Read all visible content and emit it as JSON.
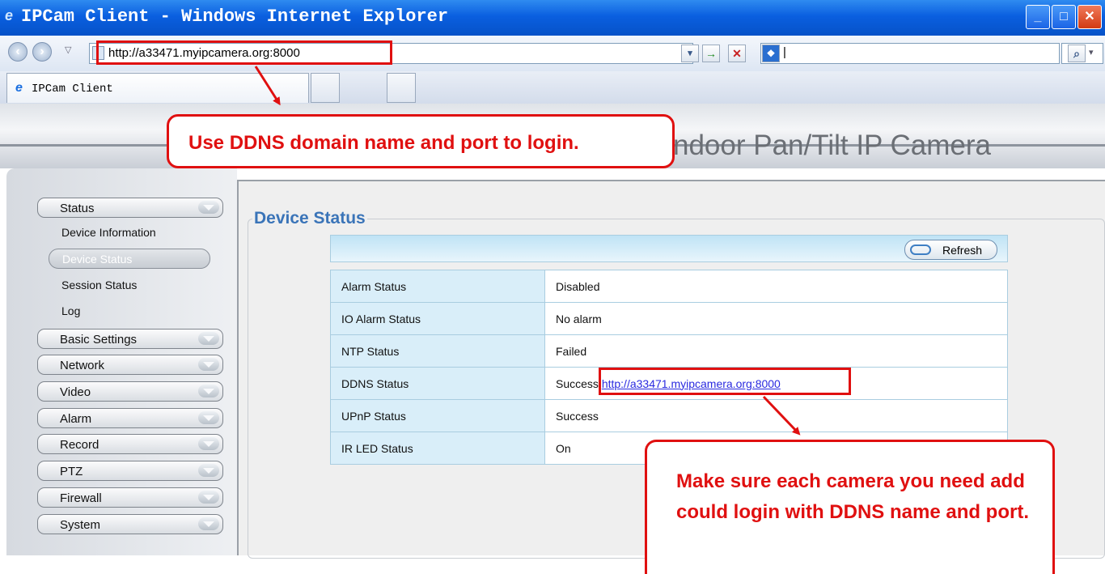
{
  "window": {
    "title": "IPCam Client - Windows Internet Explorer"
  },
  "browser": {
    "address": "http://a33471.myipcamera.org:8000",
    "search_text": "|",
    "tab_title": "IPCam Client"
  },
  "banner": {
    "title": "ndoor Pan/Tilt IP Camera"
  },
  "sidebar": {
    "status_menu": "Status",
    "status_items": [
      "Device Information",
      "Device Status",
      "Session Status",
      "Log"
    ],
    "menus": [
      "Basic Settings",
      "Network",
      "Video",
      "Alarm",
      "Record",
      "PTZ",
      "Firewall",
      "System"
    ]
  },
  "main": {
    "section_title": "Device Status",
    "refresh_label": "Refresh",
    "rows": [
      {
        "key": "Alarm Status",
        "value": "Disabled"
      },
      {
        "key": "IO Alarm Status",
        "value": "No alarm"
      },
      {
        "key": "NTP Status",
        "value": "Failed"
      },
      {
        "key": "DDNS Status",
        "value": "Success",
        "link": "http://a33471.myipcamera.org:8000"
      },
      {
        "key": "UPnP Status",
        "value": "Success"
      },
      {
        "key": "IR LED Status",
        "value": "On"
      }
    ]
  },
  "annotations": {
    "callout_login": "Use DDNS domain name and port to login.",
    "callout_camera": "Make sure each camera you need add could login with DDNS name and port."
  },
  "colors": {
    "annotation_red": "#e01010",
    "title_bar_blue": "#0a5fe0",
    "section_title_blue": "#3a74b8"
  }
}
